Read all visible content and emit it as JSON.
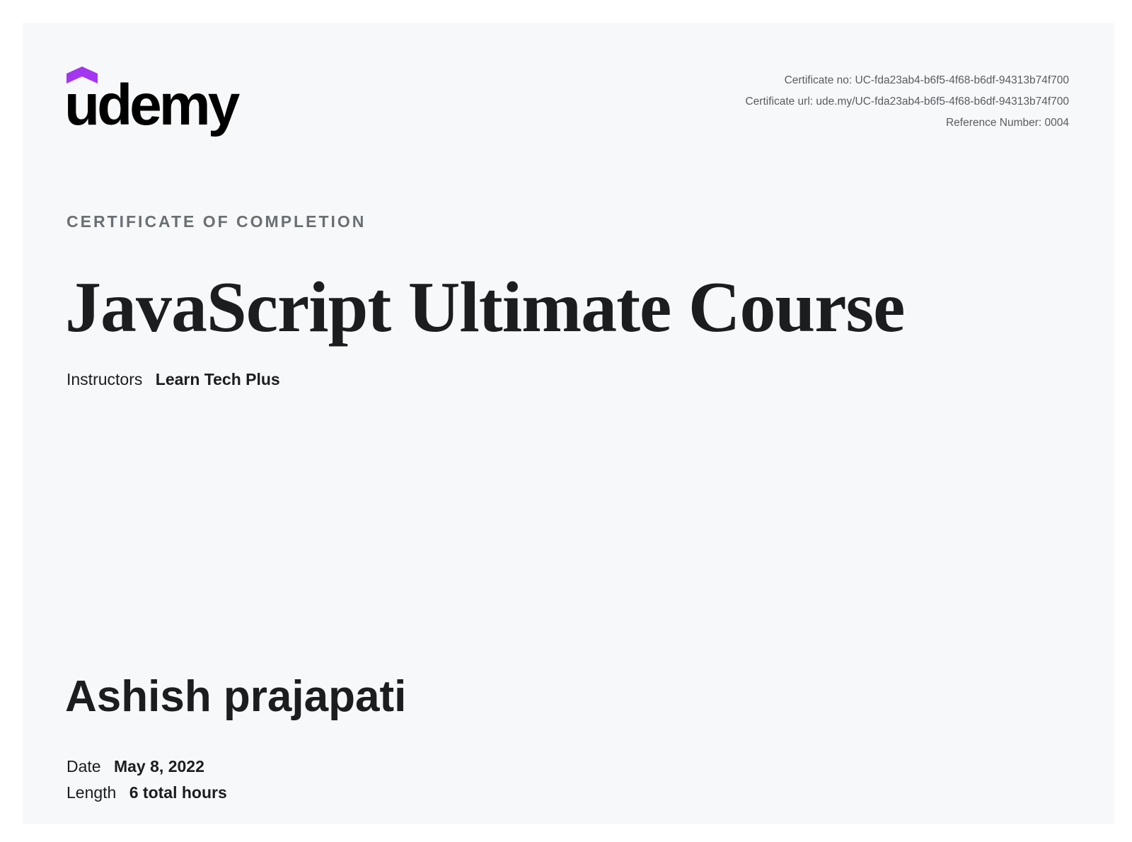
{
  "brand": {
    "name": "udemy",
    "accent_color": "#a435f0",
    "text_color": "#000000"
  },
  "meta": {
    "certificate_no": "Certificate no: UC-fda23ab4-b6f5-4f68-b6df-94313b74f700",
    "certificate_url": "Certificate url: ude.my/UC-fda23ab4-b6f5-4f68-b6df-94313b74f700",
    "reference_number": "Reference Number: 0004"
  },
  "certificate": {
    "eyebrow": "CERTIFICATE OF COMPLETION",
    "course_title": "JavaScript Ultimate Course",
    "instructors_label": "Instructors",
    "instructors_value": "Learn Tech Plus",
    "recipient": "Ashish prajapati",
    "date_label": "Date",
    "date_value": "May 8, 2022",
    "length_label": "Length",
    "length_value": "6 total hours"
  }
}
